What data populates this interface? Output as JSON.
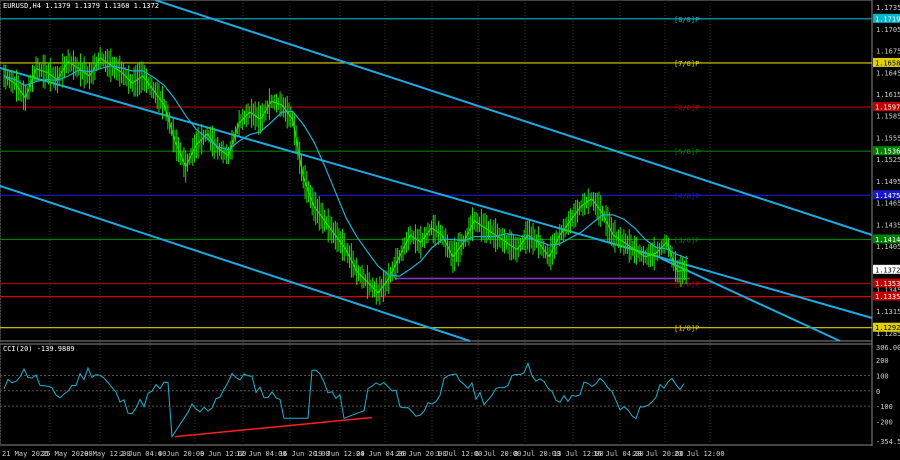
{
  "header": {
    "symbol": "EURUSD,H4",
    "ohlc": "1.1379 1.1379 1.1368 1.1372"
  },
  "oscillator": {
    "title": "CCI(20) -139.9889"
  },
  "price_axis": {
    "ticks": [
      "1.1735",
      "1.1705",
      "1.1675",
      "1.1645",
      "1.1615",
      "1.1585",
      "1.1555",
      "1.1525",
      "1.1495",
      "1.1465",
      "1.1435",
      "1.1405",
      "1.1375",
      "1.1345",
      "1.1315",
      "1.1285"
    ],
    "ylim": [
      1.1275,
      1.1745
    ]
  },
  "cci_axis": {
    "ticks": [
      "306.0021",
      "200",
      "100",
      "0",
      "-100",
      "-200",
      "-354.5583"
    ]
  },
  "murrey_levels": [
    {
      "name": "[8/8]P",
      "value": 1.1719,
      "color": "#00b6c8"
    },
    {
      "name": "[7/8]P",
      "value": 1.1658,
      "color": "#e0d000"
    },
    {
      "name": "[6/8]P",
      "value": 1.1597,
      "color": "#b00000"
    },
    {
      "name": "[5/8]P",
      "value": 1.1536,
      "color": "#008000"
    },
    {
      "name": "[4/8]P",
      "value": 1.1475,
      "color": "#1818d0"
    },
    {
      "name": "[3/8]P",
      "value": 1.1414,
      "color": "#008000"
    },
    {
      "name": "[2/8]P",
      "value": 1.1353,
      "color": "#b00000"
    },
    {
      "name": "[1/8]P",
      "value": 1.1292,
      "color": "#e0d000"
    }
  ],
  "price_labels": [
    {
      "value": 1.1719,
      "text": "1.1719",
      "bg": "#00b6c8"
    },
    {
      "value": 1.1658,
      "text": "1.1658",
      "bg": "#e0d000"
    },
    {
      "value": 1.1597,
      "text": "1.1597",
      "bg": "#c00000"
    },
    {
      "value": 1.1536,
      "text": "1.1536",
      "bg": "#008000"
    },
    {
      "value": 1.1475,
      "text": "1.1475",
      "bg": "#1818d0"
    },
    {
      "value": 1.1414,
      "text": "1.1414",
      "bg": "#008000"
    },
    {
      "value": 1.1372,
      "text": "1.1372",
      "bg": "#ffffff"
    },
    {
      "value": 1.1353,
      "text": "1.1353",
      "bg": "#c00000"
    },
    {
      "value": 1.1335,
      "text": "1.1335",
      "bg": "#c00000"
    },
    {
      "value": 1.1292,
      "text": "1.1292",
      "bg": "#e0d000"
    }
  ],
  "date_axis": [
    "21 May 2026",
    "25 May 20:00",
    "28 May 12:00",
    "2 Jun 04:00",
    "4 Jun 20:00",
    "9 Jun 12:00",
    "12 Jun 04:00",
    "16 Jun 20:00",
    "19 Jun 12:00",
    "24 Jun 04:00",
    "26 Jun 20:00",
    "1 Jul 12:00",
    "6 Jul 20:00",
    "8 Jul 20:00",
    "13 Jul 12:00",
    "16 Jul 04:00",
    "20 Jul 20:00",
    "23 Jul 12:00"
  ],
  "chart_data": {
    "type": "line",
    "series": [
      {
        "name": "EURUSD,H4",
        "values": [
          1.164,
          1.163,
          1.161,
          1.165,
          1.1645,
          1.1635,
          1.166,
          1.165,
          1.164,
          1.1665,
          1.1655,
          1.1645,
          1.163,
          1.164,
          1.162,
          1.16,
          1.155,
          1.1515,
          1.1545,
          1.156,
          1.154,
          1.153,
          1.1575,
          1.159,
          1.158,
          1.1605,
          1.16,
          1.158,
          1.15,
          1.146,
          1.144,
          1.142,
          1.14,
          1.137,
          1.1355,
          1.134,
          1.136,
          1.139,
          1.142,
          1.141,
          1.143,
          1.142,
          1.139,
          1.141,
          1.144,
          1.143,
          1.142,
          1.141,
          1.14,
          1.142,
          1.141,
          1.139,
          1.142,
          1.144,
          1.146,
          1.147,
          1.145,
          1.142,
          1.141,
          1.14,
          1.139,
          1.1395,
          1.141,
          1.137,
          1.1372
        ]
      }
    ]
  },
  "colors": {
    "price": "#21e000",
    "ma": "#20b0d0",
    "channel": "#1ea8e0",
    "cci": "#20b0d0",
    "divergence": "#ff2020"
  }
}
